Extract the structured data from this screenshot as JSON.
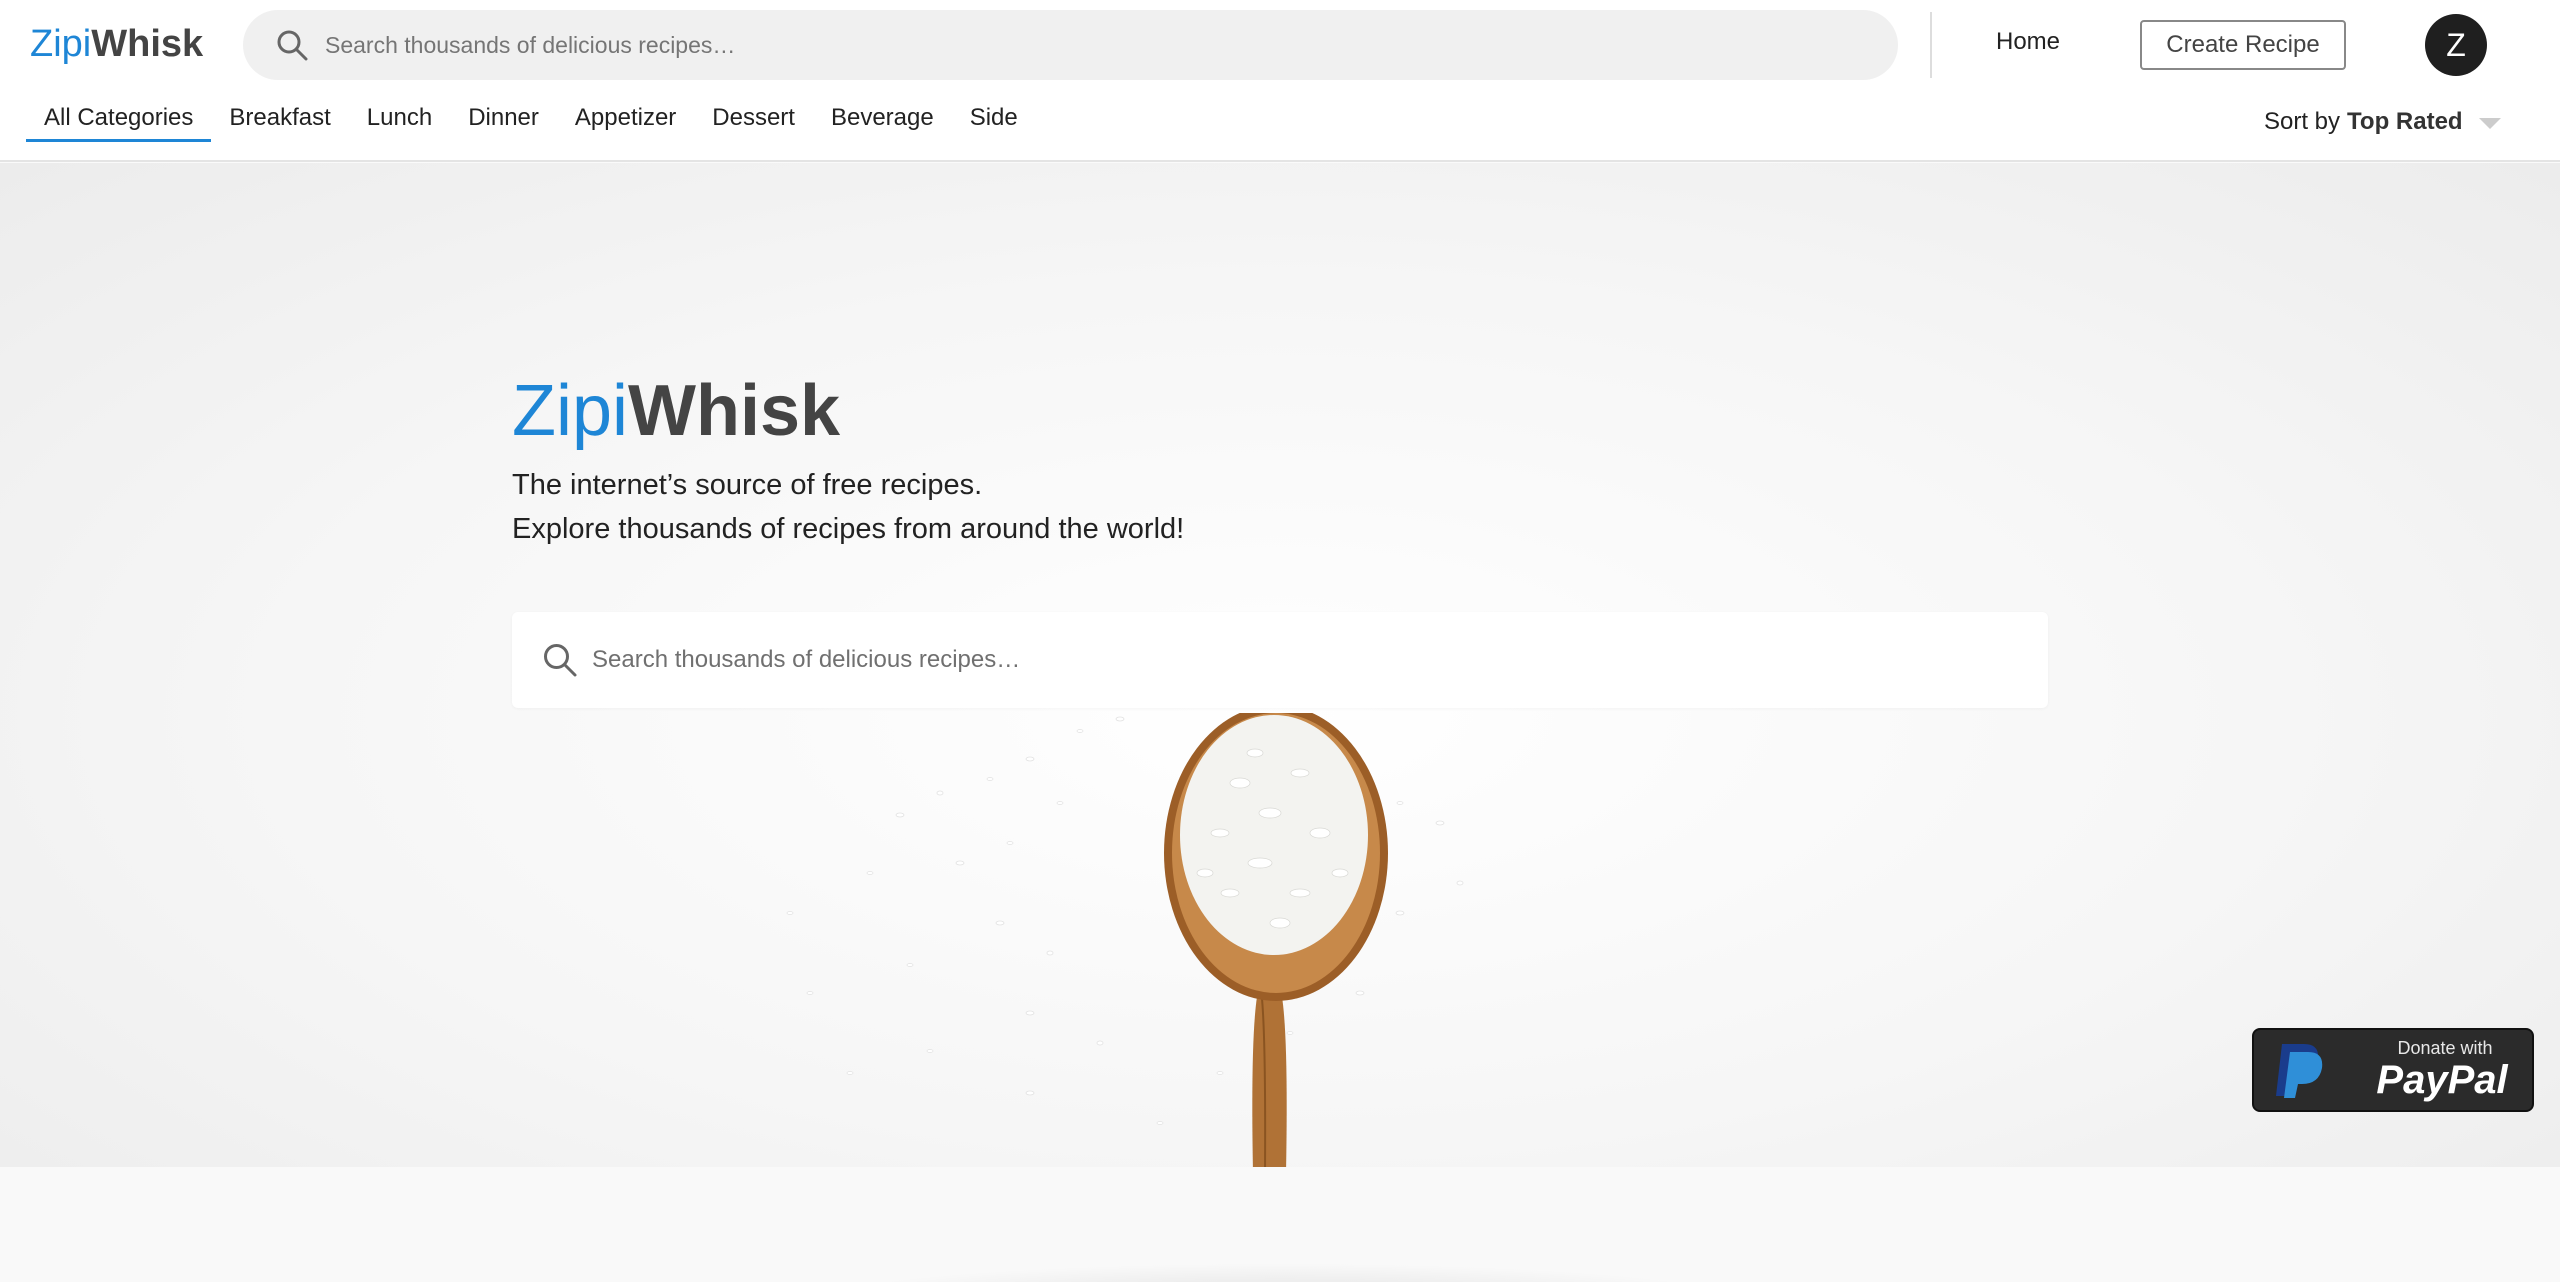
{
  "header": {
    "logo": {
      "part1": "Zipi",
      "part2": "Whisk"
    },
    "search": {
      "placeholder": "Search thousands of delicious recipes…",
      "icon": "search-icon"
    },
    "nav": {
      "home_label": "Home",
      "create_label": "Create Recipe"
    },
    "avatar": {
      "initial": "Z"
    }
  },
  "categories": {
    "tabs": [
      {
        "label": "All Categories",
        "active": true
      },
      {
        "label": "Breakfast"
      },
      {
        "label": "Lunch"
      },
      {
        "label": "Dinner"
      },
      {
        "label": "Appetizer"
      },
      {
        "label": "Dessert"
      },
      {
        "label": "Beverage"
      },
      {
        "label": "Side"
      }
    ],
    "sort": {
      "prefix": "Sort by",
      "value": "Top Rated"
    }
  },
  "hero": {
    "logo": {
      "part1": "Zipi",
      "part2": "Whisk"
    },
    "tagline_line1": "The internet’s source of free recipes.",
    "tagline_line2": "Explore thousands of recipes from around the world!",
    "search": {
      "placeholder": "Search thousands of delicious recipes…"
    }
  },
  "paypal": {
    "donate_text": "Donate with",
    "brand": "PayPal"
  },
  "colors": {
    "accent": "#1e86d6",
    "logo_dark": "#444444",
    "paypal_dark": "#2b2b2b"
  }
}
